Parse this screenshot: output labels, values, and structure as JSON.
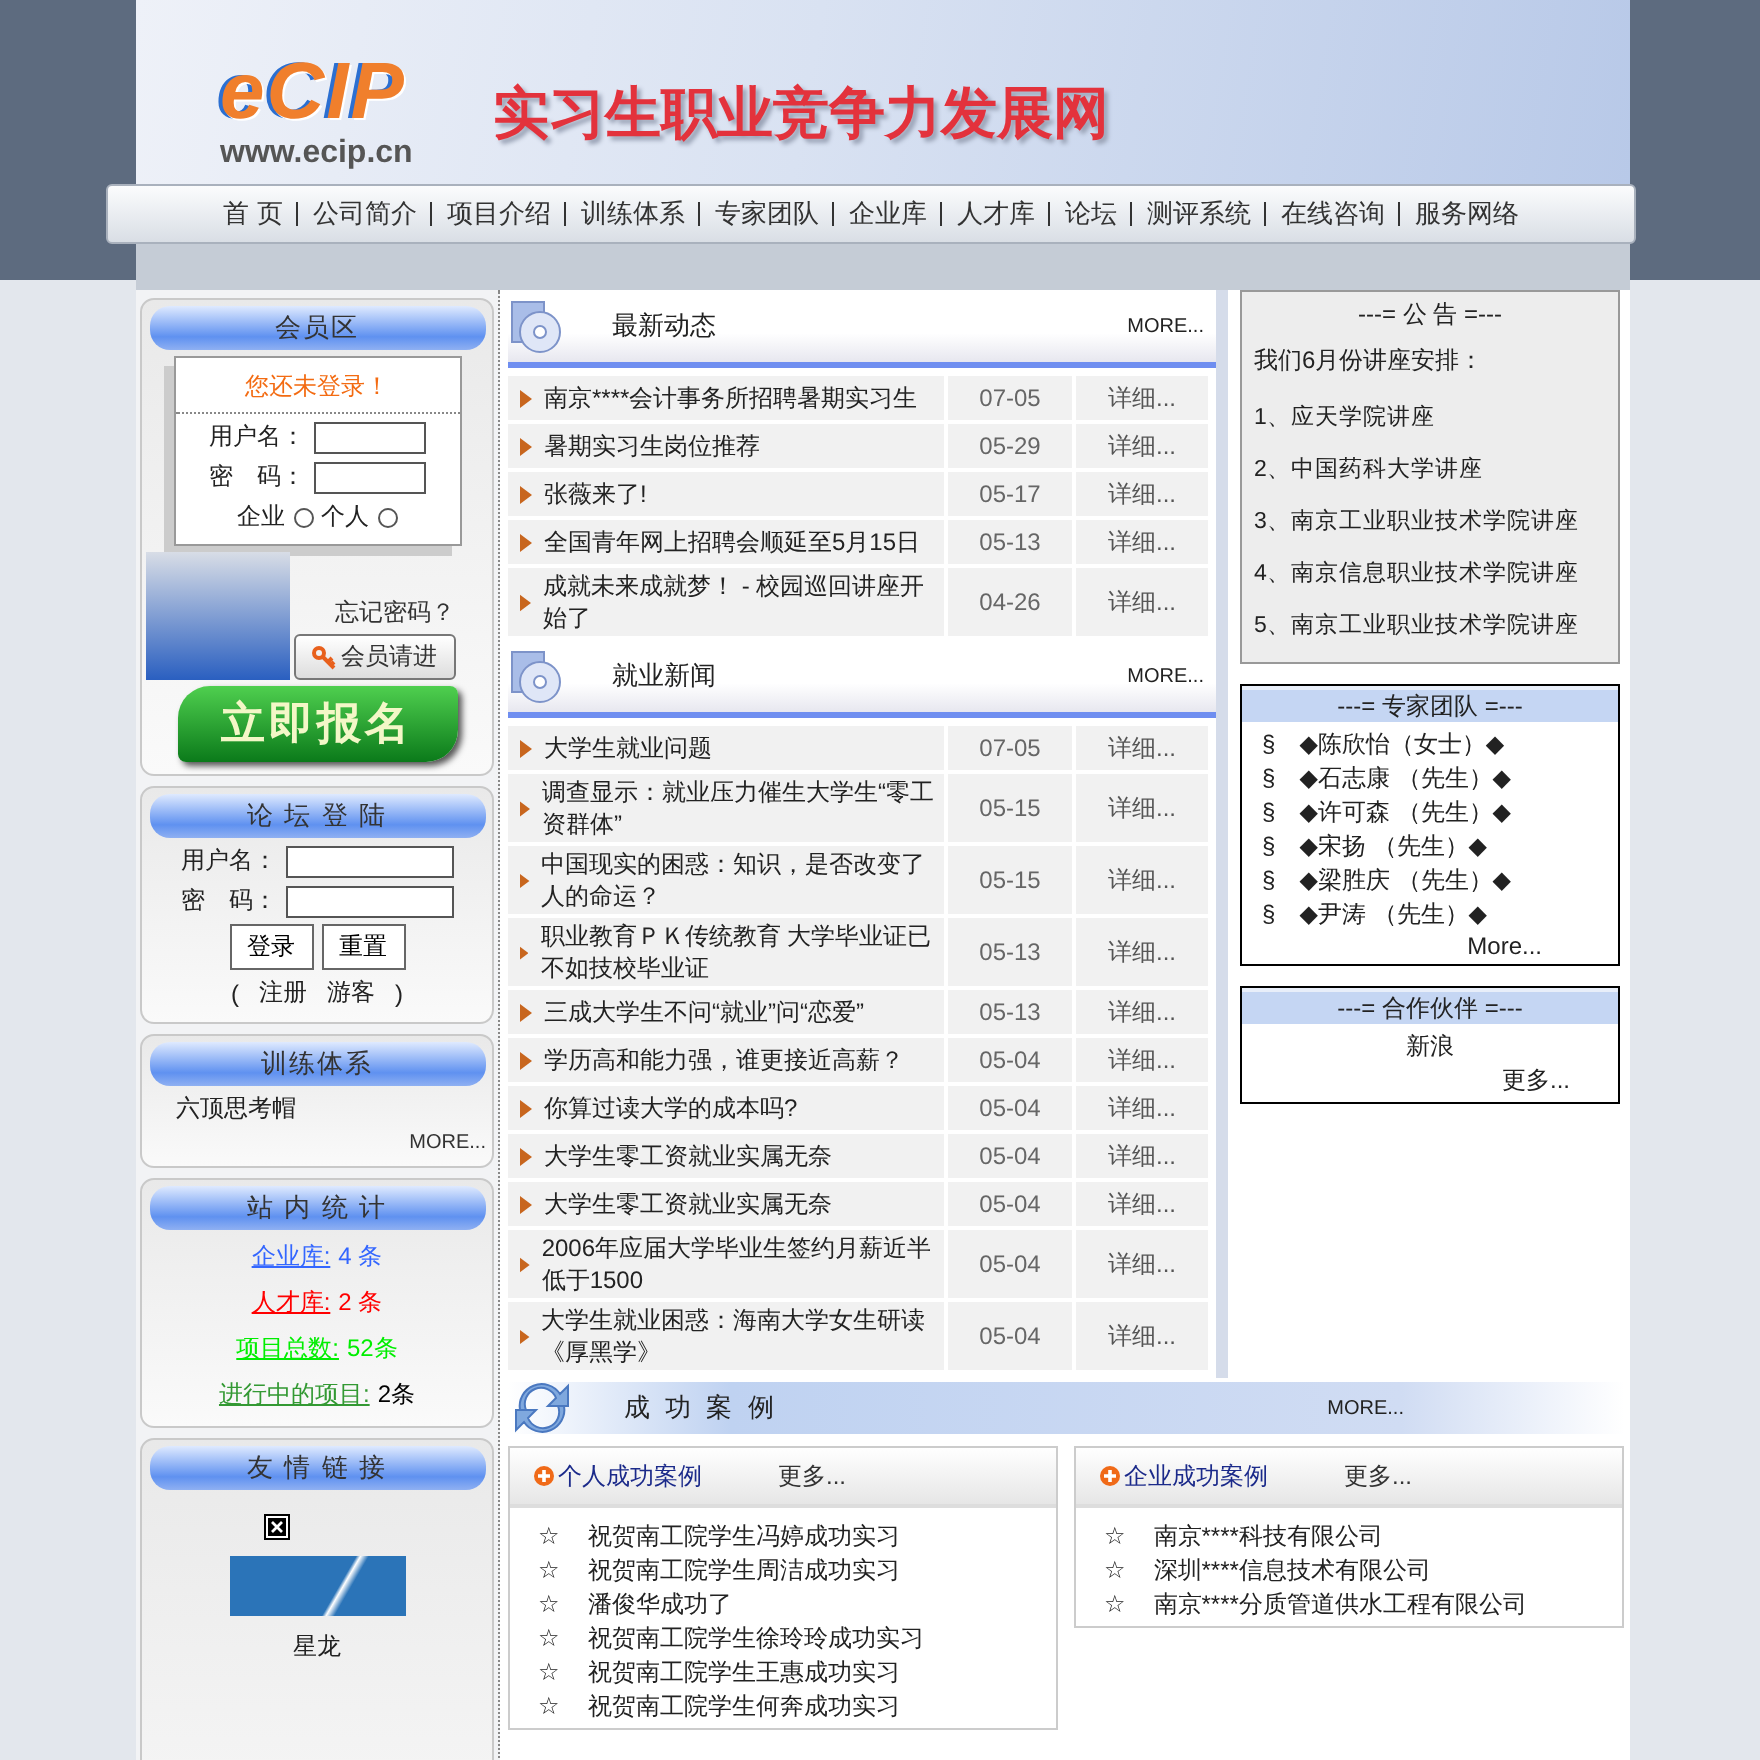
{
  "header": {
    "logo": "eCIP",
    "url": "www.ecip.cn",
    "site_title": "实习生职业竞争力发展网"
  },
  "nav": [
    "首 页",
    "公司简介",
    "项目介绍",
    "训练体系",
    "专家团队",
    "企业库",
    "人才库",
    "论坛",
    "测评系统",
    "在线咨询",
    "服务网络"
  ],
  "member": {
    "title": "会员区",
    "notice": "您还未登录！",
    "username_label": "用户名：",
    "password_label": "密　码：",
    "types": [
      {
        "label": "企业",
        "selected": false
      },
      {
        "label": "个人",
        "selected": false
      }
    ],
    "forgot": "忘记密码？",
    "login_button": "会员请进",
    "signup_button": "立即报名"
  },
  "forum": {
    "title": "论 坛 登 陆",
    "username_label": "用户名：",
    "password_label": "密　码：",
    "buttons": [
      "登录",
      "重置"
    ],
    "open": "(",
    "links": [
      "注册",
      "游客"
    ],
    "close": ")"
  },
  "training": {
    "title": "训练体系",
    "items": [
      "六顶思考帽"
    ],
    "more": "MORE..."
  },
  "stats": {
    "title": "站 内 统 计",
    "items": [
      {
        "label": "企业库:",
        "color": "#3366ff",
        "value": {
          "text": "4 条",
          "color": "#3366ff"
        }
      },
      {
        "label": "人才库:",
        "color": "#ff0000",
        "value": {
          "text": "2 条",
          "color": "#ff0000"
        }
      },
      {
        "label": "项目总数:",
        "color": "#00ee00",
        "value": {
          "text": "52条",
          "color": "#00ee00"
        }
      },
      {
        "label": "进行中的项目:",
        "color": "#339933",
        "value": {
          "text": "2条",
          "color": "#000000"
        }
      }
    ]
  },
  "friend_links": {
    "title": "友 情 链 接",
    "caption": "星龙"
  },
  "news": [
    {
      "title": "最新动态",
      "more": "MORE...",
      "rows": [
        {
          "title": "南京****会计事务所招聘暑期实习生",
          "date": "07-05",
          "action": "详细..."
        },
        {
          "title": "暑期实习生岗位推荐",
          "date": "05-29",
          "action": "详细..."
        },
        {
          "title": "张薇来了!",
          "date": "05-17",
          "action": "详细..."
        },
        {
          "title": "全国青年网上招聘会顺延至5月15日",
          "date": "05-13",
          "action": "详细..."
        },
        {
          "title": "成就未来成就梦！ - 校园巡回讲座开始了",
          "date": "04-26",
          "action": "详细..."
        }
      ]
    },
    {
      "title": "就业新闻",
      "more": "MORE...",
      "rows": [
        {
          "title": "大学生就业问题",
          "date": "07-05",
          "action": "详细..."
        },
        {
          "title": "调查显示：就业压力催生大学生“零工资群体”",
          "date": "05-15",
          "action": "详细..."
        },
        {
          "title": "中国现实的困惑：知识，是否改变了人的命运？",
          "date": "05-15",
          "action": "详细..."
        },
        {
          "title": "职业教育ＰＫ传统教育 大学毕业证已不如技校毕业证",
          "date": "05-13",
          "action": "详细..."
        },
        {
          "title": "三成大学生不问“就业”问“恋爱”",
          "date": "05-13",
          "action": "详细..."
        },
        {
          "title": "学历高和能力强，谁更接近高薪？",
          "date": "05-04",
          "action": "详细..."
        },
        {
          "title": "你算过读大学的成本吗?",
          "date": "05-04",
          "action": "详细..."
        },
        {
          "title": "大学生零工资就业实属无奈",
          "date": "05-04",
          "action": "详细..."
        },
        {
          "title": "大学生零工资就业实属无奈",
          "date": "05-04",
          "action": "详细..."
        },
        {
          "title": "2006年应届大学毕业生签约月薪近半低于1500",
          "date": "05-04",
          "action": "详细..."
        },
        {
          "title": "大学生就业困惑：海南大学女生研读《厚黑学》",
          "date": "05-04",
          "action": "详细..."
        }
      ]
    }
  ],
  "notice": {
    "title": "---= 公 告 =---",
    "intro": "我们6月份讲座安排：",
    "items": [
      "1、应天学院讲座",
      "2、中国药科大学讲座",
      "3、南京工业职业技术学院讲座",
      "4、南京信息职业技术学院讲座",
      "5、南京工业职业技术学院讲座"
    ]
  },
  "experts": {
    "title": "---= 专家团队 =---",
    "items": [
      {
        "mark": "§",
        "name": "◆陈欣怡（女士）◆"
      },
      {
        "mark": "§",
        "name": "◆石志康 （先生）◆"
      },
      {
        "mark": "§",
        "name": "◆许可森 （先生）◆"
      },
      {
        "mark": "§",
        "name": "◆宋扬 （先生）◆"
      },
      {
        "mark": "§",
        "name": "◆梁胜庆 （先生）◆"
      },
      {
        "mark": "§",
        "name": "◆尹涛 （先生）◆"
      }
    ],
    "more": "More..."
  },
  "partners": {
    "title": "---= 合作伙伴 =---",
    "items": [
      "新浪"
    ],
    "more": "更多..."
  },
  "success": {
    "title": "成 功 案 例",
    "more": "MORE...",
    "boxes": [
      {
        "title": "个人成功案例",
        "more": "更多...",
        "bullet": "☆",
        "items": [
          "祝贺南工院学生冯婷成功实习",
          "祝贺南工院学生周洁成功实习",
          "潘俊华成功了",
          "祝贺南工院学生徐玲玲成功实习",
          "祝贺南工院学生王惠成功实习",
          "祝贺南工院学生何奔成功实习"
        ]
      },
      {
        "title": "企业成功案例",
        "more": "更多...",
        "bullet": "☆",
        "items": [
          "南京****科技有限公司",
          "深圳****信息技术有限公司",
          "南京****分质管道供水工程有限公司"
        ]
      }
    ]
  }
}
